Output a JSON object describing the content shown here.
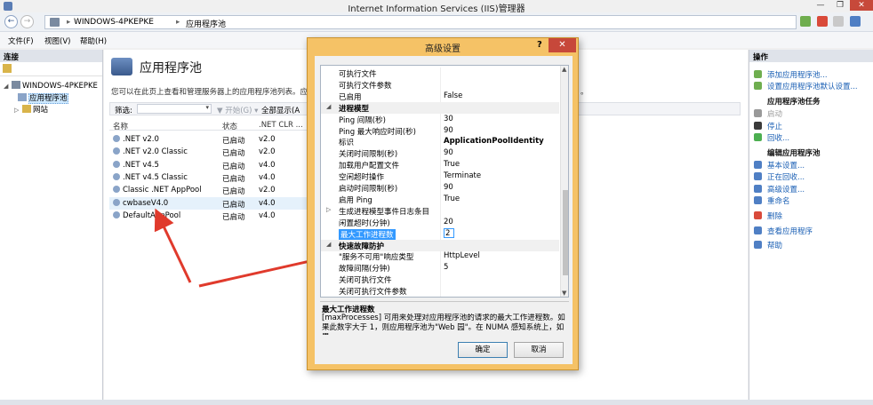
{
  "window": {
    "title": "Internet Information Services (IIS)管理器",
    "min": "—",
    "max": "❐",
    "close": "✕"
  },
  "address": {
    "back": "←",
    "forward": "→",
    "separator": "▸",
    "breadcrumb": [
      "WINDOWS-4PKEPKE",
      "应用程序池"
    ]
  },
  "menu": [
    "文件(F)",
    "视图(V)",
    "帮助(H)"
  ],
  "left": {
    "header": "连接",
    "tree": [
      {
        "label": "WINDOWS-4PKEPKE",
        "expander": "◢"
      },
      {
        "label": "应用程序池",
        "expander": ""
      },
      {
        "label": "网站",
        "expander": "▷"
      }
    ]
  },
  "center": {
    "title": "应用程序池",
    "description": "您可以在此页上查看和管理服务器上的应用程序池列表。应用",
    "description_tail": "。",
    "filter": {
      "label": "筛选:",
      "arrow": "▾",
      "go": "▼ 开始(G) ▾",
      "show_all": "全部显示(A"
    },
    "columns": [
      "名称",
      "状态",
      ".NET CLR ..."
    ],
    "rows": [
      {
        "name": ".NET v2.0",
        "status": "已启动",
        "clr": "v2.0"
      },
      {
        "name": ".NET v2.0 Classic",
        "status": "已启动",
        "clr": "v2.0"
      },
      {
        "name": ".NET v4.5",
        "status": "已启动",
        "clr": "v4.0"
      },
      {
        "name": ".NET v4.5 Classic",
        "status": "已启动",
        "clr": "v4.0"
      },
      {
        "name": "Classic .NET AppPool",
        "status": "已启动",
        "clr": "v2.0"
      },
      {
        "name": "cwbaseV4.0",
        "status": "已启动",
        "clr": "v4.0"
      },
      {
        "name": "DefaultAppPool",
        "status": "已启动",
        "clr": "v4.0"
      }
    ]
  },
  "actions": {
    "header": "操作",
    "items": [
      {
        "label": "添加应用程序池...",
        "type": "link"
      },
      {
        "label": "设置应用程序池默认设置...",
        "type": "link"
      },
      {
        "label": "应用程序池任务",
        "type": "section"
      },
      {
        "label": "启动",
        "type": "disabled"
      },
      {
        "label": "停止",
        "type": "link"
      },
      {
        "label": "回收...",
        "type": "link"
      },
      {
        "label": "编辑应用程序池",
        "type": "section"
      },
      {
        "label": "基本设置...",
        "type": "link"
      },
      {
        "label": "正在回收...",
        "type": "link"
      },
      {
        "label": "高级设置...",
        "type": "link"
      },
      {
        "label": "重命名",
        "type": "link"
      },
      {
        "label": "删除",
        "type": "link"
      },
      {
        "label": "查看应用程序",
        "type": "link"
      },
      {
        "label": "帮助",
        "type": "link"
      }
    ]
  },
  "dialog": {
    "title": "高级设置",
    "help": "?",
    "close": "✕",
    "rows": [
      {
        "name": "可执行文件",
        "value": ""
      },
      {
        "name": "可执行文件参数",
        "value": ""
      },
      {
        "name": "已启用",
        "value": "False"
      },
      {
        "name": "进程模型",
        "value": "",
        "category": true,
        "expander": "◢"
      },
      {
        "name": "Ping 间隔(秒)",
        "value": "30"
      },
      {
        "name": "Ping 最大响应时间(秒)",
        "value": "90"
      },
      {
        "name": "标识",
        "value": "ApplicationPoolIdentity",
        "bold": true
      },
      {
        "name": "关闭时间限制(秒)",
        "value": "90"
      },
      {
        "name": "加载用户配置文件",
        "value": "True"
      },
      {
        "name": "空闲超时操作",
        "value": "Terminate"
      },
      {
        "name": "启动时间限制(秒)",
        "value": "90"
      },
      {
        "name": "启用 Ping",
        "value": "True"
      },
      {
        "name": "生成进程模型事件日志条目",
        "value": "",
        "expander": "▷"
      },
      {
        "name": "闲置超时(分钟)",
        "value": "20"
      },
      {
        "name": "最大工作进程数",
        "value": "2",
        "selected": true
      },
      {
        "name": "快速故障防护",
        "value": "",
        "category": true,
        "expander": "◢"
      },
      {
        "name": "\"服务不可用\"响应类型",
        "value": "HttpLevel"
      },
      {
        "name": "故障间隔(分钟)",
        "value": "5"
      },
      {
        "name": "关闭可执行文件",
        "value": ""
      },
      {
        "name": "关闭可执行文件参数",
        "value": ""
      }
    ],
    "scroll_up": "▲",
    "scroll_down": "▼",
    "desc_title": "最大工作进程数",
    "desc_text": "[maxProcesses] 可用来处理对应用程序池的请求的最大工作进程数。如果此数字大于 1，则应用程序池为\"Web 园\"。在 NUMA 感知系统上，如果...",
    "ok": "确定",
    "cancel": "取消"
  },
  "colors": {
    "dialog_frame": "#f5c266",
    "close_red": "#c7483a",
    "arrow_red": "#e03a2c",
    "link_blue": "#1a5fb4",
    "selection_blue": "#3399ff"
  }
}
